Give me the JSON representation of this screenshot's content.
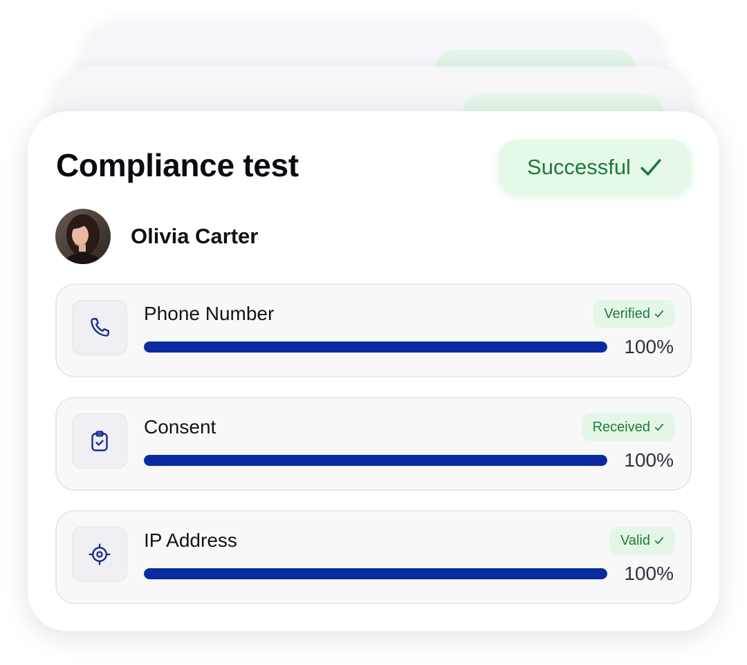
{
  "card": {
    "title": "Compliance test",
    "status": {
      "label": "Successful",
      "icon": "check-icon"
    }
  },
  "user": {
    "name": "Olivia Carter",
    "avatar": "avatar-photo"
  },
  "checks": [
    {
      "label": "Phone Number",
      "badge": "Verified",
      "icon": "phone-icon",
      "progress_percent": 100,
      "value_text": "100%"
    },
    {
      "label": "Consent",
      "badge": "Received",
      "icon": "clipboard-check-icon",
      "progress_percent": 100,
      "value_text": "100%"
    },
    {
      "label": "IP Address",
      "badge": "Valid",
      "icon": "target-icon",
      "progress_percent": 100,
      "value_text": "100%"
    }
  ],
  "colors": {
    "accent_bar": "#0a2ba0",
    "success_text": "#1b7a3c",
    "success_bg": "#e6f8e8",
    "icon_color": "#1a2a8a"
  }
}
